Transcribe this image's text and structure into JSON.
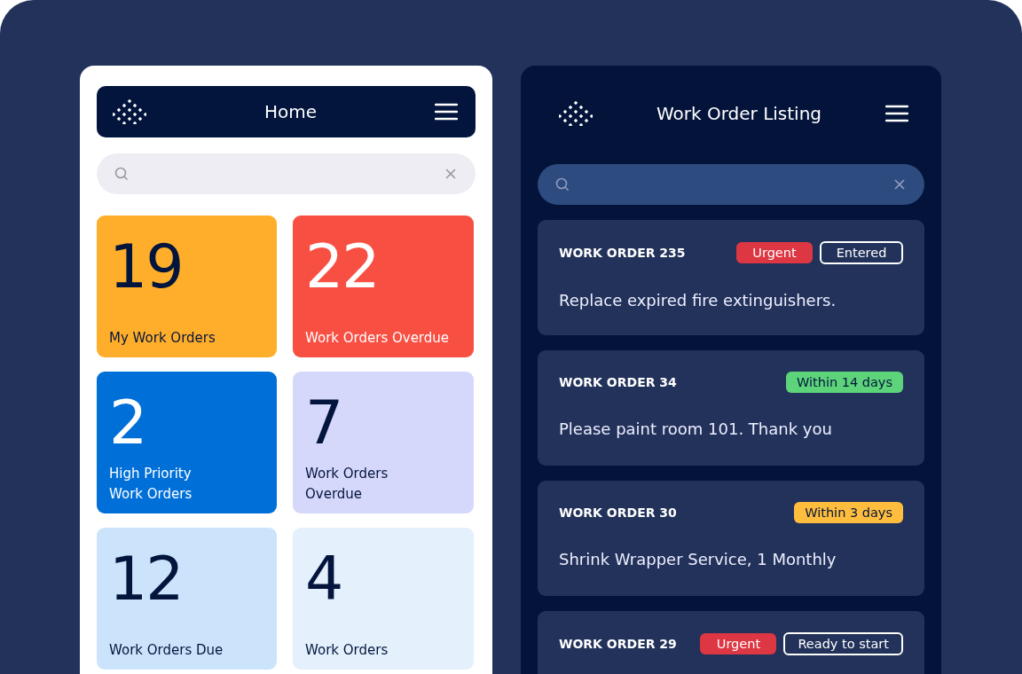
{
  "home": {
    "title": "Home",
    "tiles": [
      {
        "count": "19",
        "label": "My Work Orders",
        "color": "#ffae2b"
      },
      {
        "count": "22",
        "label": "Work Orders Overdue",
        "color": "#f84f43"
      },
      {
        "count": "2",
        "label": "High Priority Work Orders",
        "color": "#0070d8"
      },
      {
        "count": "7",
        "label": "Work Orders Overdue",
        "color": "#d5d7fb"
      },
      {
        "count": "12",
        "label": "Work Orders Due",
        "color": "#cce4fb"
      },
      {
        "count": "4",
        "label": "Work Orders",
        "color": "#e4f0fc"
      }
    ]
  },
  "listing": {
    "title": "Work Order Listing",
    "orders": [
      {
        "number": "WORK ORDER 235",
        "description": "Replace expired fire extinguishers.",
        "tags": [
          {
            "label": "Urgent",
            "kind": "filled",
            "color": "#dc3742"
          },
          {
            "label": "Entered",
            "kind": "outline"
          }
        ]
      },
      {
        "number": "WORK ORDER 34",
        "description": "Please paint room 101. Thank you",
        "tags": [
          {
            "label": "Within 14 days",
            "kind": "filled",
            "color": "#5dd47a"
          }
        ]
      },
      {
        "number": "WORK ORDER 30",
        "description": "Shrink Wrapper Service, 1 Monthly",
        "tags": [
          {
            "label": "Within 3 days",
            "kind": "filled",
            "color": "#ffbd3d"
          }
        ]
      },
      {
        "number": "WORK ORDER 29",
        "tags": [
          {
            "label": "Urgent",
            "kind": "filled",
            "color": "#dc3742"
          },
          {
            "label": "Ready to start",
            "kind": "outline"
          }
        ]
      }
    ]
  }
}
